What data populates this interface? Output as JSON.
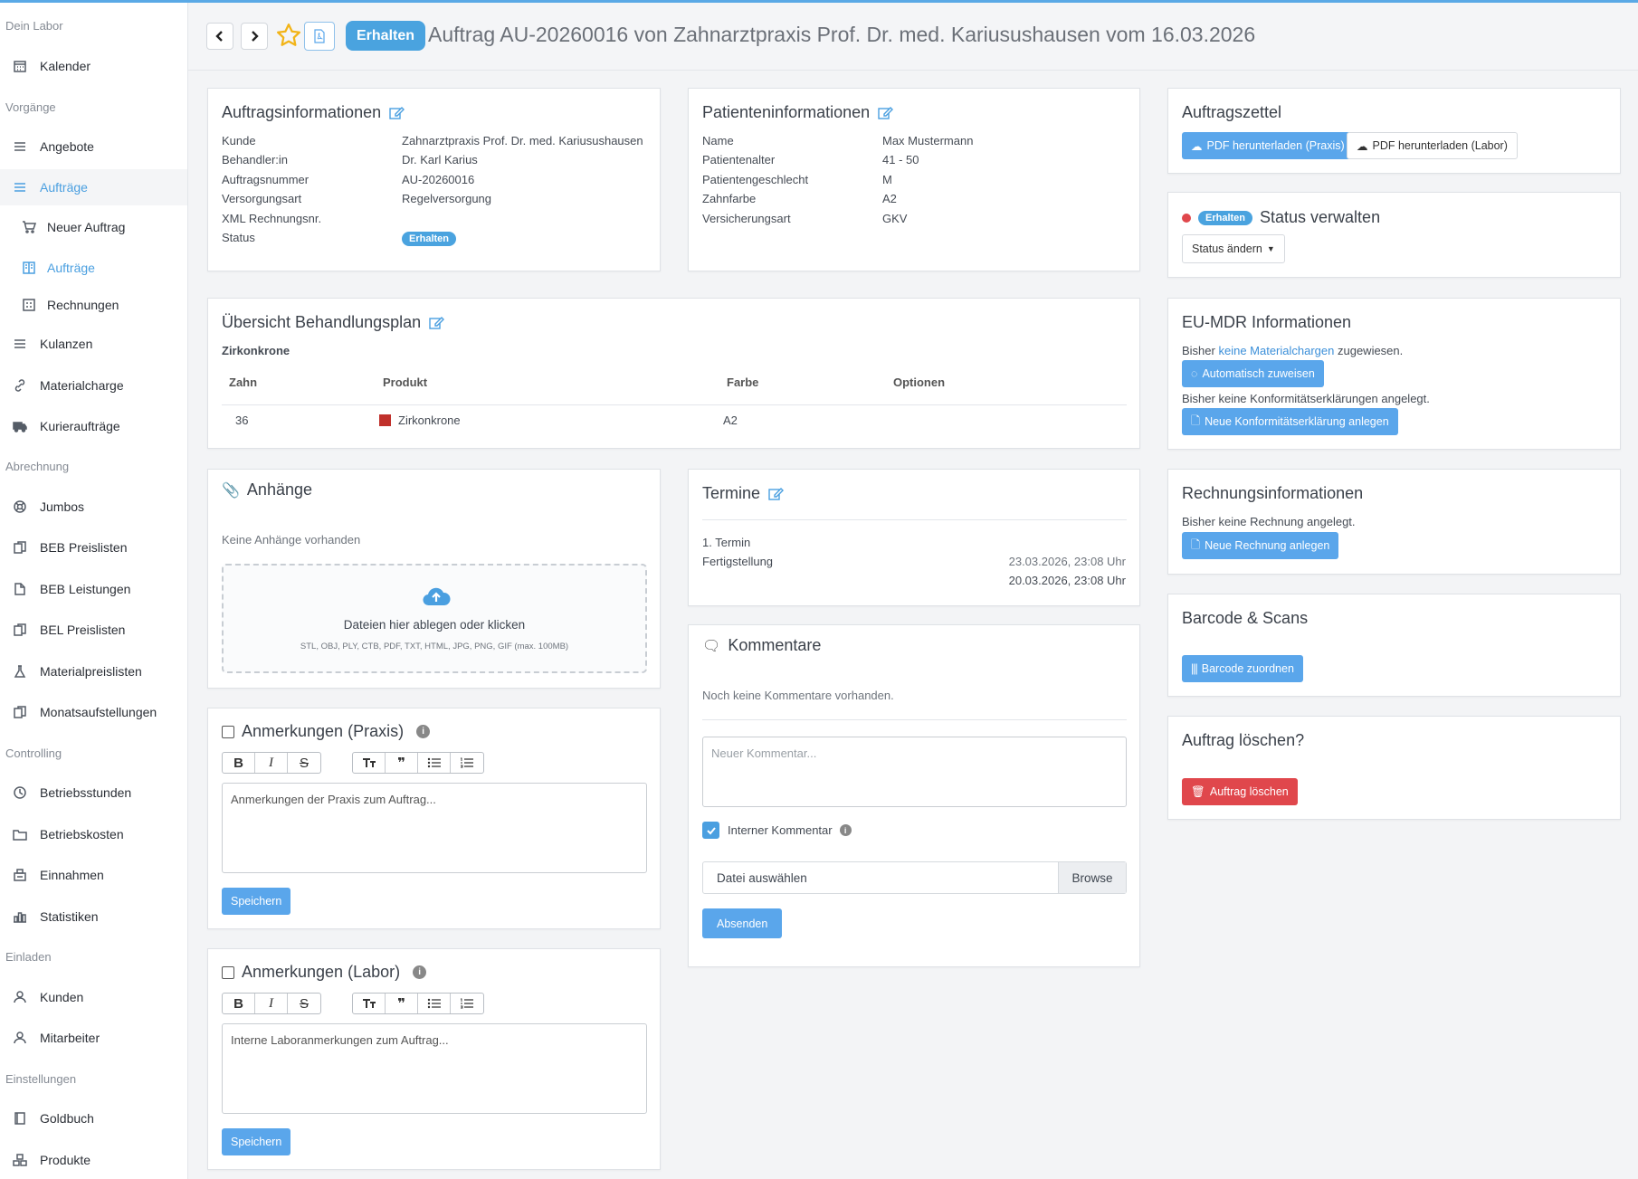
{
  "sidebar": {
    "sections": {
      "dein_labor": "Dein Labor",
      "vorgaenge": "Vorgänge",
      "abrechnung": "Abrechnung",
      "controlling": "Controlling",
      "einladen": "Einladen",
      "einstellungen": "Einstellungen"
    },
    "items": {
      "kalender": "Kalender",
      "angebote": "Angebote",
      "auftraege": "Aufträge",
      "neuer_auftrag": "Neuer Auftrag",
      "auftraege_sub": "Aufträge",
      "rechnungen": "Rechnungen",
      "kulanzen": "Kulanzen",
      "materialcharge": "Materialcharge",
      "kurierauftraege": "Kurieraufträge",
      "jumbos": "Jumbos",
      "beb_preislisten": "BEB Preislisten",
      "beb_leistungen": "BEB Leistungen",
      "bel_preislisten": "BEL Preislisten",
      "materialpreislisten": "Materialpreislisten",
      "monatsaufstellungen": "Monatsaufstellungen",
      "betriebsstunden": "Betriebsstunden",
      "betriebskosten": "Betriebskosten",
      "einnahmen": "Einnahmen",
      "statistiken": "Statistiken",
      "kunden": "Kunden",
      "mitarbeiter": "Mitarbeiter",
      "goldbuch": "Goldbuch",
      "produkte": "Produkte"
    }
  },
  "header": {
    "status": "Erhalten",
    "title": "Auftrag AU-20260016 von Zahnarztpraxis Prof. Dr. med. Kariusushausen vom 16.03.2026"
  },
  "auftragsinfo": {
    "title": "Auftragsinformationen",
    "rows": [
      {
        "label": "Kunde",
        "value": "Zahnarztpraxis Prof. Dr. med. Kariusushausen"
      },
      {
        "label": "Behandler:in",
        "value": "Dr. Karl Karius"
      },
      {
        "label": "Auftragsnummer",
        "value": "AU-20260016"
      },
      {
        "label": "Versorgungsart",
        "value": "Regelversorgung"
      },
      {
        "label": "XML Rechnungsnr.",
        "value": ""
      },
      {
        "label": "Status",
        "value": "Erhalten"
      }
    ]
  },
  "patient": {
    "title": "Patienteninformationen",
    "rows": [
      {
        "label": "Name",
        "value": "Max Mustermann"
      },
      {
        "label": "Patientenalter",
        "value": "41 - 50"
      },
      {
        "label": "Patientengeschlecht",
        "value": "M"
      },
      {
        "label": "Zahnfarbe",
        "value": "A2"
      },
      {
        "label": "Versicherungsart",
        "value": "GKV"
      }
    ]
  },
  "auftragszettel": {
    "title": "Auftragszettel",
    "pdf_praxis": "PDF herunterladen (Praxis)",
    "pdf_labor": "PDF herunterladen (Labor)"
  },
  "status_card": {
    "badge": "Erhalten",
    "title": "Status verwalten",
    "dropdown": "Status ändern",
    "dot_color": "#e0474c"
  },
  "plan": {
    "title": "Übersicht Behandlungsplan",
    "group": "Zirkonkrone",
    "headers": [
      "Zahn",
      "Produkt",
      "Farbe",
      "Optionen"
    ],
    "rows": [
      {
        "zahn": "36",
        "produkt": "Zirkonkrone",
        "farbe": "A2",
        "optionen": "",
        "color": "#c0302b"
      }
    ]
  },
  "eumdr": {
    "title": "EU-MDR Informationen",
    "line1_pre": "Bisher ",
    "line1_link": "keine Materialchargen",
    "line1_post": " zugewiesen.",
    "btn_auto": "Automatisch zuweisen",
    "line2": "Bisher keine Konformitätserklärungen angelegt.",
    "btn_konf": "Neue Konformitätserklärung anlegen"
  },
  "anhaenge": {
    "title": "Anhänge",
    "empty": "Keine Anhänge vorhanden",
    "drop_text": "Dateien hier ablegen oder klicken",
    "drop_formats": "STL, OBJ, PLY, CTB, PDF, TXT, HTML, JPG, PNG, GIF (max. 100MB)"
  },
  "termine": {
    "title": "Termine",
    "label1": "1. Termin",
    "label2": "Fertigstellung",
    "date1": "23.03.2026, 23:08 Uhr",
    "date2": "20.03.2026, 23:08 Uhr"
  },
  "rechnung": {
    "title": "Rechnungsinformationen",
    "text": "Bisher keine Rechnung angelegt.",
    "btn": "Neue Rechnung anlegen"
  },
  "barcode": {
    "title": "Barcode & Scans",
    "btn": "Barcode zuordnen"
  },
  "loeschen": {
    "title": "Auftrag löschen?",
    "btn": "Auftrag löschen"
  },
  "kommentare": {
    "title": "Kommentare",
    "empty": "Noch keine Kommentare vorhanden.",
    "placeholder": "Neuer Kommentar...",
    "intern_label": "Interner Kommentar",
    "file_label": "Datei auswählen",
    "browse": "Browse",
    "submit": "Absenden"
  },
  "anm_praxis": {
    "title": "Anmerkungen (Praxis)",
    "placeholder": "Anmerkungen der Praxis zum Auftrag...",
    "save": "Speichern"
  },
  "anm_labor": {
    "title": "Anmerkungen (Labor)",
    "placeholder": "Interne Laboranmerkungen zum Auftrag...",
    "save": "Speichern"
  },
  "editor": {
    "bold": "B",
    "italic": "I",
    "strike": "S",
    "quote": "❞"
  }
}
